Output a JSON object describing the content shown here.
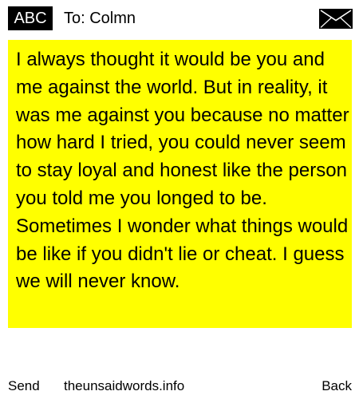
{
  "header": {
    "mode_badge": "ABC",
    "recipient": "To: Colmn",
    "icon": "envelope-icon"
  },
  "message": {
    "text": "I always thought it would be you and me against the world. But in reality, it was me against you because no matter how hard I tried, you could never seem to stay loyal and honest like the person you told me you longed to be. Sometimes I wonder what things would be like if you didn't lie or cheat. I guess we will never know."
  },
  "footer": {
    "left_softkey": "Send",
    "site": "theunsaidwords.info",
    "right_softkey": "Back"
  },
  "colors": {
    "highlight": "#ffff00",
    "badge_background": "#000000",
    "badge_text": "#ffffff",
    "text": "#000000",
    "background": "#ffffff"
  }
}
